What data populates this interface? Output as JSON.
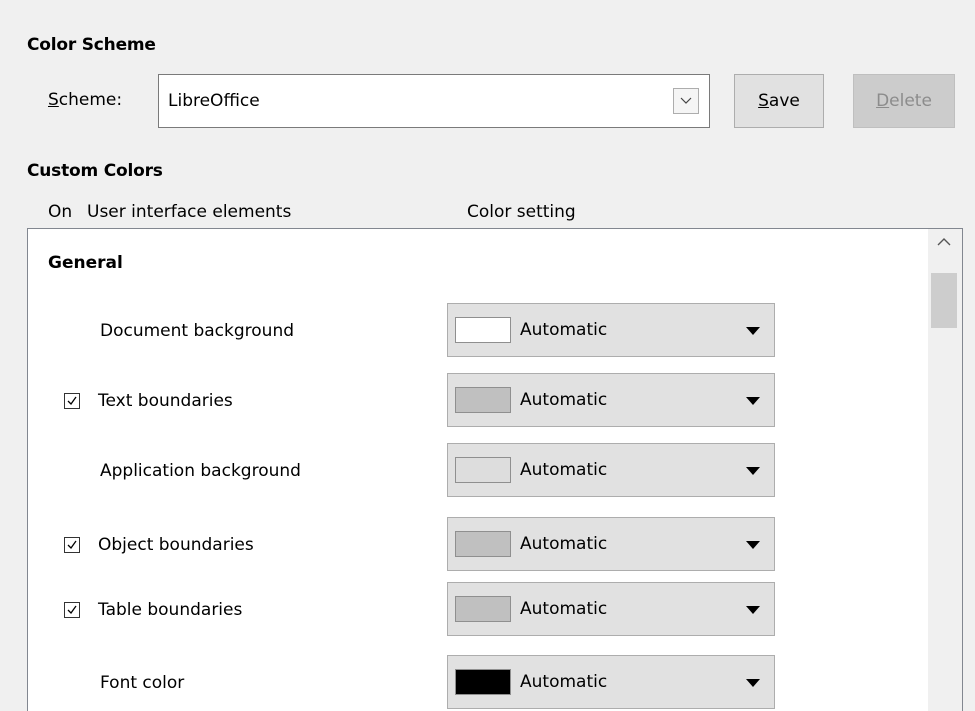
{
  "color_scheme": {
    "title": "Color Scheme",
    "scheme_label": "Scheme:",
    "scheme_value": "LibreOffice",
    "save_label": "Save",
    "delete_label": "Delete"
  },
  "custom_colors": {
    "title": "Custom Colors",
    "columns": {
      "on": "On",
      "elements": "User interface elements",
      "color": "Color setting"
    },
    "group": "General",
    "rows": [
      {
        "label": "Document background",
        "checkbox": false,
        "color": "Automatic",
        "swatch": "#ffffff"
      },
      {
        "label": "Text boundaries",
        "checkbox": true,
        "color": "Automatic",
        "swatch": "#c0c0c0"
      },
      {
        "label": "Application background",
        "checkbox": false,
        "color": "Automatic",
        "swatch": "#dddddd"
      },
      {
        "label": "Object boundaries",
        "checkbox": true,
        "color": "Automatic",
        "swatch": "#c0c0c0"
      },
      {
        "label": "Table boundaries",
        "checkbox": true,
        "color": "Automatic",
        "swatch": "#c0c0c0"
      },
      {
        "label": "Font color",
        "checkbox": false,
        "color": "Automatic",
        "swatch": "#000000"
      }
    ]
  }
}
